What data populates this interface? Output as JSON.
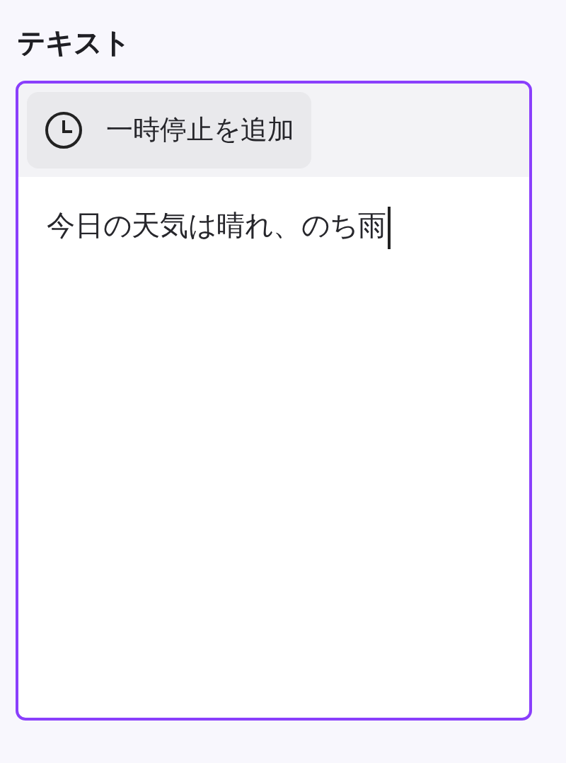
{
  "label": "テキスト",
  "toolbar": {
    "buttons": [
      {
        "label": "一時停止を追加"
      }
    ]
  },
  "field": {
    "value": "今日の天気は晴れ、のち雨",
    "focused": true
  }
}
